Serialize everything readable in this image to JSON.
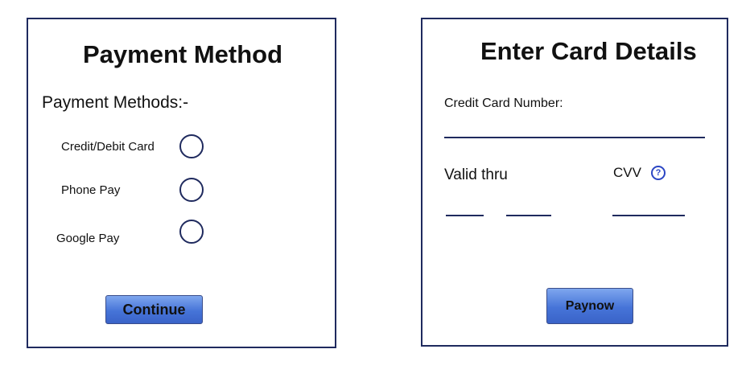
{
  "payment_method": {
    "title": "Payment Method",
    "section_label": "Payment Methods:-",
    "options": [
      {
        "label": "Credit/Debit Card"
      },
      {
        "label": "Phone Pay"
      },
      {
        "label": "Google Pay"
      }
    ],
    "continue_label": "Continue"
  },
  "card_details": {
    "title": "Enter Card Details",
    "card_number_label": "Credit Card Number:",
    "valid_thru_label": "Valid thru",
    "cvv_label": "CVV",
    "help_icon": "question-mark-circle",
    "pay_label": "Paynow"
  },
  "colors": {
    "border": "#1f2a5e",
    "button_top": "#7ea6ee",
    "button_bottom": "#3a63c8",
    "help_icon": "#2b46c4"
  }
}
